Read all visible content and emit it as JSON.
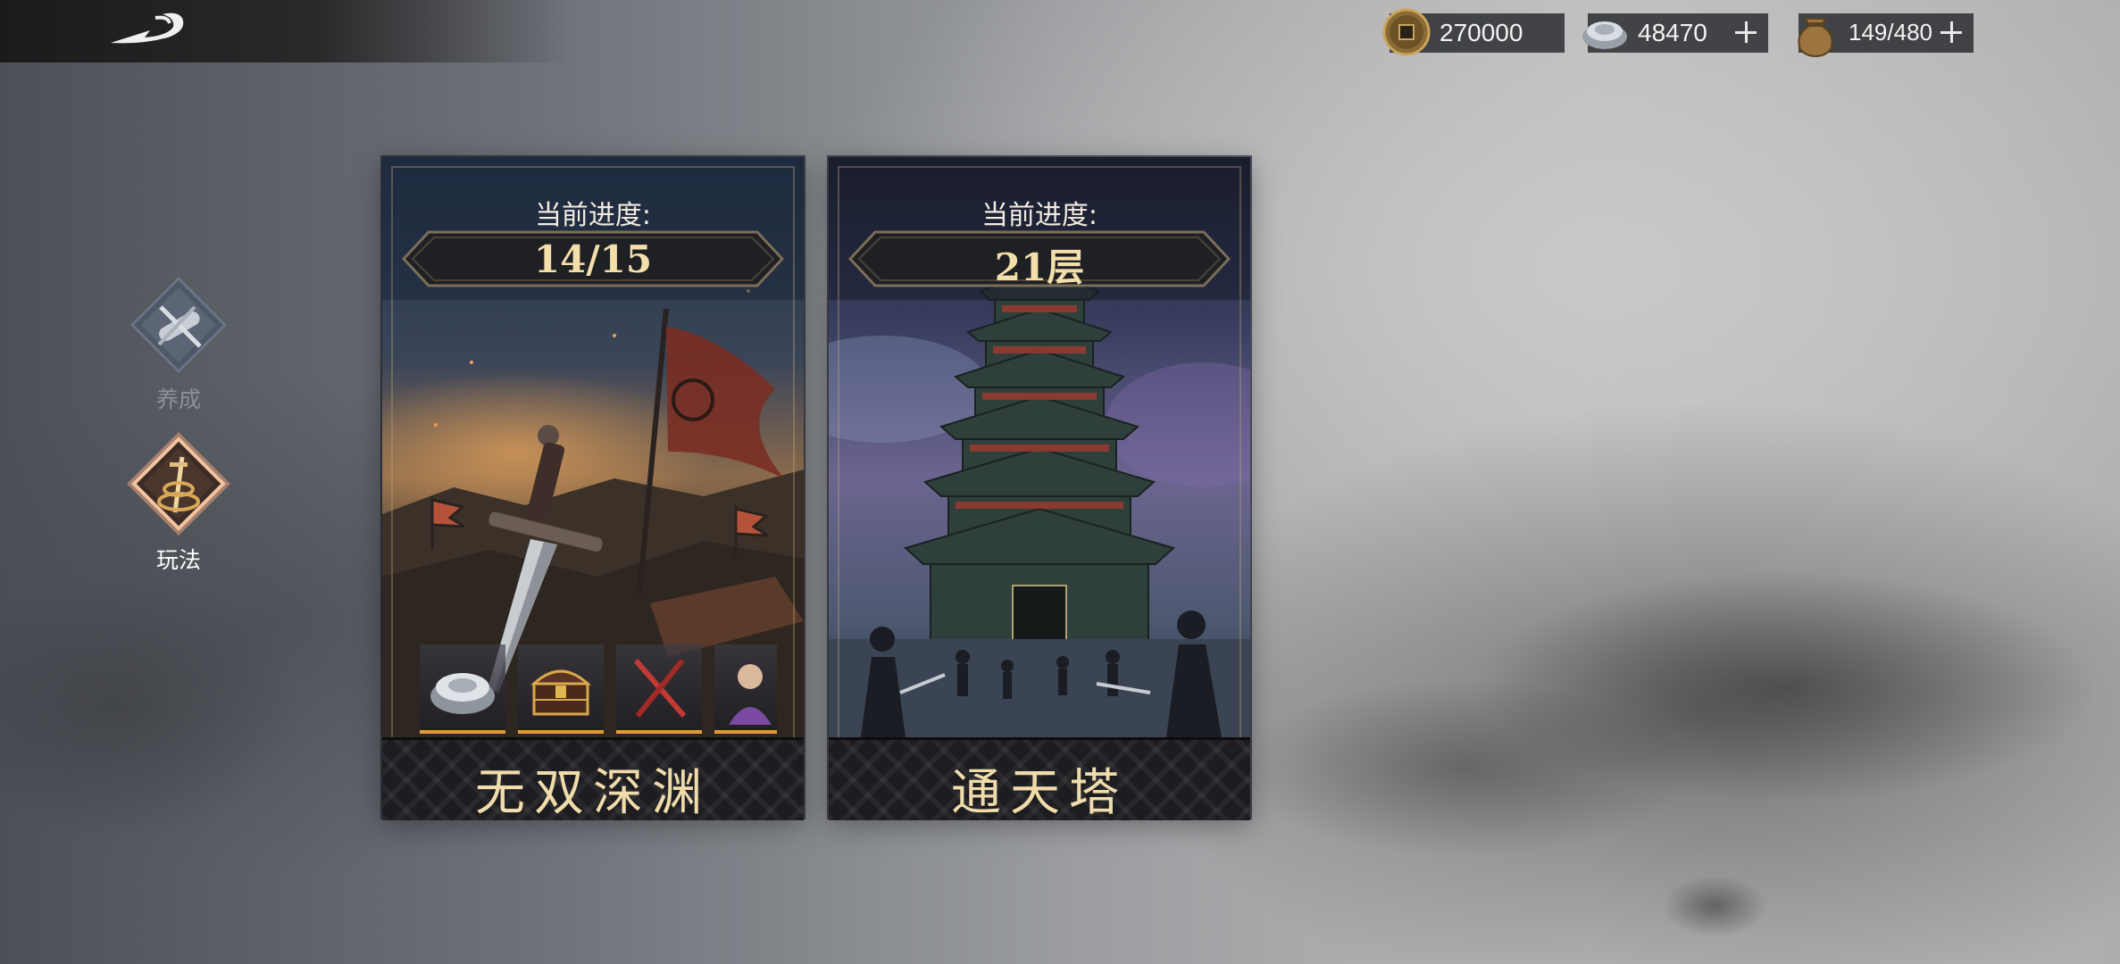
{
  "resources": [
    {
      "icon": "copper-coin-icon",
      "value": "270000"
    },
    {
      "icon": "silver-ingot-icon",
      "value": "48470"
    },
    {
      "icon": "grain-sack-icon",
      "value": "149/480"
    }
  ],
  "nav": {
    "items": [
      {
        "label": "养成",
        "icon": "scroll-sword-icon",
        "active": false
      },
      {
        "label": "玩法",
        "icon": "sword-coil-icon",
        "active": true
      }
    ]
  },
  "cards": [
    {
      "progress_label": "当前进度:",
      "progress_value": "14/15",
      "name": "无双深渊",
      "rewards": [
        "silver-ingot-icon",
        "treasure-chest-icon",
        "crossed-swords-icon",
        "hero-portrait-icon"
      ]
    },
    {
      "progress_label": "当前进度:",
      "progress_value": "21层",
      "name": "通天塔"
    }
  ],
  "colors": {
    "accent_gold": "#f4dfaa",
    "reward_underline": "#e49a34",
    "active_nav_glow": "#e7a27a"
  }
}
